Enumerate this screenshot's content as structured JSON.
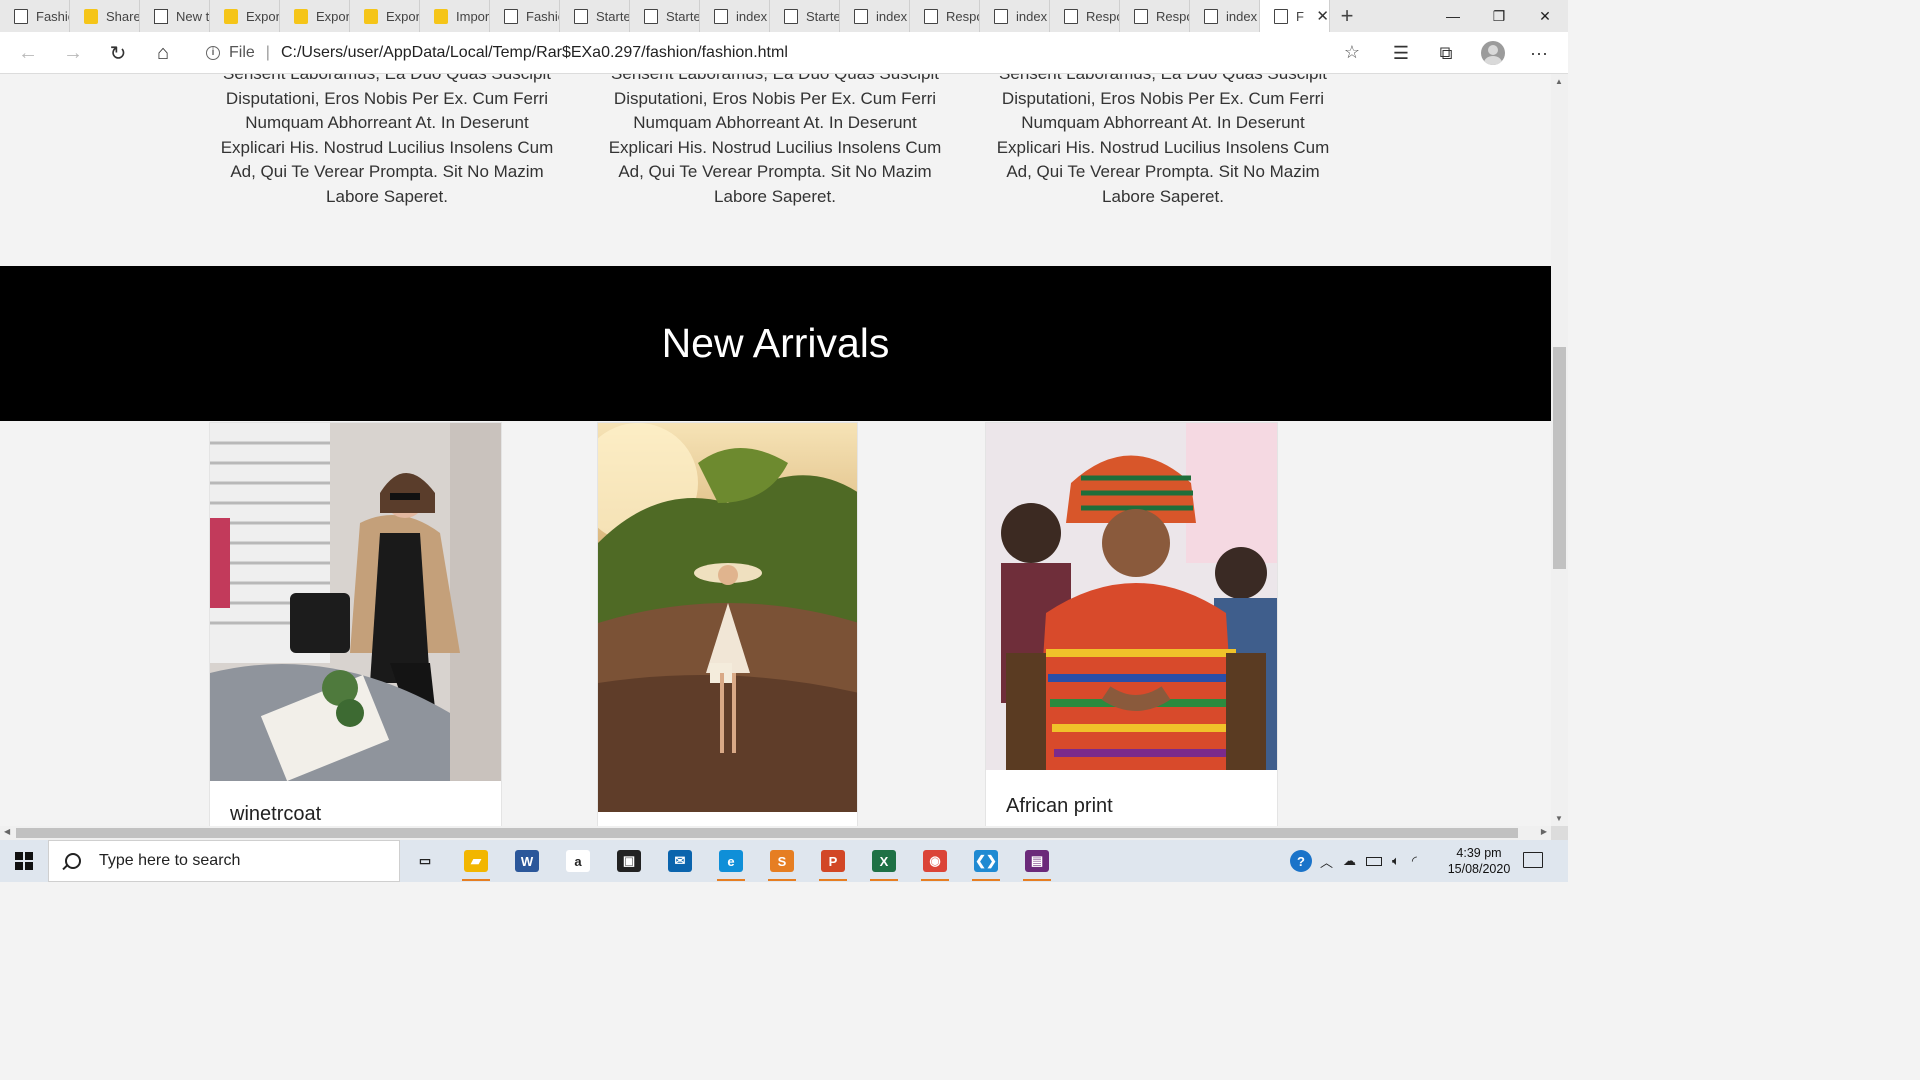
{
  "browser": {
    "tabs": [
      {
        "label": "Fashic",
        "icon": "page-icon"
      },
      {
        "label": "Share",
        "icon": "folder-icon"
      },
      {
        "label": "New t",
        "icon": "newtab-icon"
      },
      {
        "label": "Expor",
        "icon": "folder-icon"
      },
      {
        "label": "Expor",
        "icon": "folder-icon"
      },
      {
        "label": "Expor",
        "icon": "folder-icon"
      },
      {
        "label": "Impor",
        "icon": "folder-icon"
      },
      {
        "label": "Fashic",
        "icon": "page-icon"
      },
      {
        "label": "Starte",
        "icon": "page-icon"
      },
      {
        "label": "Starte",
        "icon": "page-icon"
      },
      {
        "label": "index",
        "icon": "page-icon"
      },
      {
        "label": "Starte",
        "icon": "page-icon"
      },
      {
        "label": "index",
        "icon": "page-icon"
      },
      {
        "label": "Respo",
        "icon": "page-icon"
      },
      {
        "label": "index",
        "icon": "page-icon"
      },
      {
        "label": "Respo",
        "icon": "page-icon"
      },
      {
        "label": "Respo",
        "icon": "page-icon"
      },
      {
        "label": "index",
        "icon": "page-icon"
      }
    ],
    "active_tab": {
      "label": "F",
      "close": "✕"
    },
    "new_tab": "+",
    "window_controls": {
      "minimize": "—",
      "restore": "❐",
      "close": "✕"
    },
    "address": {
      "scheme_label": "File",
      "separator": "|",
      "url": "C:/Users/user/AppData/Local/Temp/Rar$EXa0.297/fashion/fashion.html"
    },
    "nav": {
      "back": "←",
      "forward": "→",
      "refresh": "↻",
      "home": "⌂",
      "favorite": "☆",
      "favorites": "☰",
      "collections": "⧉",
      "menu": "···"
    }
  },
  "page": {
    "about_text": "Sensent Laboramus, Ea Duo Quas Suscipit Disputationi, Eros Nobis Per Ex. Cum Ferri Numquam Abhorreant At. In Deserunt Explicari His. Nostrud Lucilius Insolens Cum Ad, Qui Te Verear Prompta. Sit No Mazim Labore Saperet.",
    "section_title": "New Arrivals",
    "products": [
      {
        "caption": "winetrcoat"
      },
      {
        "caption": ""
      },
      {
        "caption": "African print"
      }
    ]
  },
  "taskbar": {
    "search_placeholder": "Type here to search",
    "apps": [
      {
        "name": "task-view",
        "color": "#dfe6ee"
      },
      {
        "name": "file-explorer",
        "color": "#f2b600"
      },
      {
        "name": "word",
        "color": "#2b579a"
      },
      {
        "name": "amazon",
        "color": "#ffffff"
      },
      {
        "name": "store",
        "color": "#222222"
      },
      {
        "name": "mail",
        "color": "#0a64ad"
      },
      {
        "name": "edge",
        "color": "#0f8fd8"
      },
      {
        "name": "sublime",
        "color": "#e67e22"
      },
      {
        "name": "powerpoint",
        "color": "#d24726"
      },
      {
        "name": "excel",
        "color": "#1e7145"
      },
      {
        "name": "chrome",
        "color": "#db4437"
      },
      {
        "name": "vscode",
        "color": "#1f8ad2"
      },
      {
        "name": "winrar",
        "color": "#6b2a7a"
      }
    ],
    "time": "4:39 pm",
    "date": "15/08/2020"
  }
}
